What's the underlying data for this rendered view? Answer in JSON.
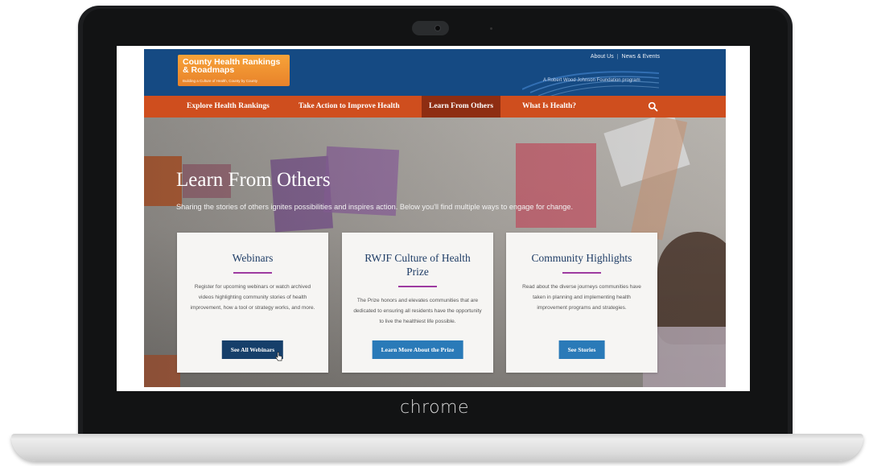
{
  "device": {
    "brand": "chrome"
  },
  "site": {
    "logo": {
      "line1": "County Health Rankings & Roadmaps",
      "tagline": "Building a Culture of Health, County by County"
    },
    "utility_links": [
      "About Us",
      "News & Events"
    ],
    "rwjf_text": "A Robert Wood Johnson Foundation program",
    "nav": [
      {
        "label": "Explore Health Rankings",
        "active": false
      },
      {
        "label": "Take Action to Improve Health",
        "active": false
      },
      {
        "label": "Learn From Others",
        "active": true
      },
      {
        "label": "What Is Health?",
        "active": false
      }
    ],
    "search_icon": "search-icon",
    "hero": {
      "title": "Learn From Others",
      "subtitle": "Sharing the stories of others ignites possibilities and inspires action. Below you'll find multiple ways to engage for change."
    },
    "cards": [
      {
        "title": "Webinars",
        "description": "Register for upcoming webinars or watch archived videos highlighting community stories of health improvement, how a tool or strategy works, and more.",
        "button": "See All Webinars"
      },
      {
        "title": "RWJF Culture of Health Prize",
        "description": "The Prize honors and elevates communities that are dedicated to ensuring all residents have the opportunity to live the healthiest life possible.",
        "button": "Learn More About the Prize"
      },
      {
        "title": "Community Highlights",
        "description": "Read about the diverse journeys communities have taken in planning and implementing health improvement programs and strategies.",
        "button": "See Stories"
      }
    ],
    "colors": {
      "header_blue": "#154a83",
      "nav_orange": "#cf4e1e",
      "nav_active": "#8e2d12",
      "accent_purple": "#9d3aa0",
      "button_blue": "#2a7ab8"
    }
  }
}
